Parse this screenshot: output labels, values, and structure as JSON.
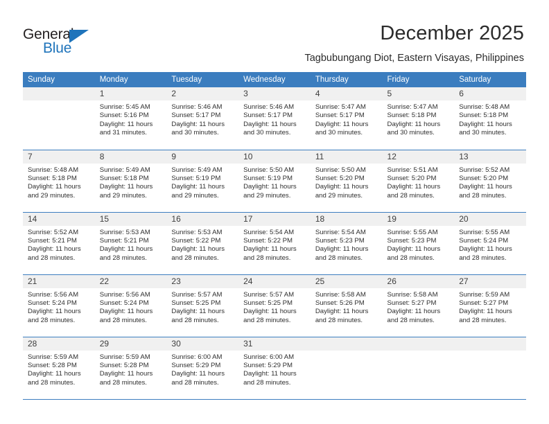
{
  "brand": {
    "name_top": "General",
    "name_bottom": "Blue",
    "accent_color": "#1f74bb"
  },
  "header": {
    "title": "December 2025",
    "subtitle": "Tagbubungang Diot, Eastern Visayas, Philippines"
  },
  "calendar": {
    "header_bg": "#3b7dbf",
    "daynum_bg": "#f0f0f0",
    "weekdays": [
      "Sunday",
      "Monday",
      "Tuesday",
      "Wednesday",
      "Thursday",
      "Friday",
      "Saturday"
    ],
    "weeks": [
      [
        {
          "day": "",
          "blank": true,
          "sunrise": "",
          "sunset": "",
          "daylight1": "",
          "daylight2": ""
        },
        {
          "day": "1",
          "sunrise": "Sunrise: 5:45 AM",
          "sunset": "Sunset: 5:16 PM",
          "daylight1": "Daylight: 11 hours",
          "daylight2": "and 31 minutes."
        },
        {
          "day": "2",
          "sunrise": "Sunrise: 5:46 AM",
          "sunset": "Sunset: 5:17 PM",
          "daylight1": "Daylight: 11 hours",
          "daylight2": "and 30 minutes."
        },
        {
          "day": "3",
          "sunrise": "Sunrise: 5:46 AM",
          "sunset": "Sunset: 5:17 PM",
          "daylight1": "Daylight: 11 hours",
          "daylight2": "and 30 minutes."
        },
        {
          "day": "4",
          "sunrise": "Sunrise: 5:47 AM",
          "sunset": "Sunset: 5:17 PM",
          "daylight1": "Daylight: 11 hours",
          "daylight2": "and 30 minutes."
        },
        {
          "day": "5",
          "sunrise": "Sunrise: 5:47 AM",
          "sunset": "Sunset: 5:18 PM",
          "daylight1": "Daylight: 11 hours",
          "daylight2": "and 30 minutes."
        },
        {
          "day": "6",
          "sunrise": "Sunrise: 5:48 AM",
          "sunset": "Sunset: 5:18 PM",
          "daylight1": "Daylight: 11 hours",
          "daylight2": "and 30 minutes."
        }
      ],
      [
        {
          "day": "7",
          "sunrise": "Sunrise: 5:48 AM",
          "sunset": "Sunset: 5:18 PM",
          "daylight1": "Daylight: 11 hours",
          "daylight2": "and 29 minutes."
        },
        {
          "day": "8",
          "sunrise": "Sunrise: 5:49 AM",
          "sunset": "Sunset: 5:18 PM",
          "daylight1": "Daylight: 11 hours",
          "daylight2": "and 29 minutes."
        },
        {
          "day": "9",
          "sunrise": "Sunrise: 5:49 AM",
          "sunset": "Sunset: 5:19 PM",
          "daylight1": "Daylight: 11 hours",
          "daylight2": "and 29 minutes."
        },
        {
          "day": "10",
          "sunrise": "Sunrise: 5:50 AM",
          "sunset": "Sunset: 5:19 PM",
          "daylight1": "Daylight: 11 hours",
          "daylight2": "and 29 minutes."
        },
        {
          "day": "11",
          "sunrise": "Sunrise: 5:50 AM",
          "sunset": "Sunset: 5:20 PM",
          "daylight1": "Daylight: 11 hours",
          "daylight2": "and 29 minutes."
        },
        {
          "day": "12",
          "sunrise": "Sunrise: 5:51 AM",
          "sunset": "Sunset: 5:20 PM",
          "daylight1": "Daylight: 11 hours",
          "daylight2": "and 28 minutes."
        },
        {
          "day": "13",
          "sunrise": "Sunrise: 5:52 AM",
          "sunset": "Sunset: 5:20 PM",
          "daylight1": "Daylight: 11 hours",
          "daylight2": "and 28 minutes."
        }
      ],
      [
        {
          "day": "14",
          "sunrise": "Sunrise: 5:52 AM",
          "sunset": "Sunset: 5:21 PM",
          "daylight1": "Daylight: 11 hours",
          "daylight2": "and 28 minutes."
        },
        {
          "day": "15",
          "sunrise": "Sunrise: 5:53 AM",
          "sunset": "Sunset: 5:21 PM",
          "daylight1": "Daylight: 11 hours",
          "daylight2": "and 28 minutes."
        },
        {
          "day": "16",
          "sunrise": "Sunrise: 5:53 AM",
          "sunset": "Sunset: 5:22 PM",
          "daylight1": "Daylight: 11 hours",
          "daylight2": "and 28 minutes."
        },
        {
          "day": "17",
          "sunrise": "Sunrise: 5:54 AM",
          "sunset": "Sunset: 5:22 PM",
          "daylight1": "Daylight: 11 hours",
          "daylight2": "and 28 minutes."
        },
        {
          "day": "18",
          "sunrise": "Sunrise: 5:54 AM",
          "sunset": "Sunset: 5:23 PM",
          "daylight1": "Daylight: 11 hours",
          "daylight2": "and 28 minutes."
        },
        {
          "day": "19",
          "sunrise": "Sunrise: 5:55 AM",
          "sunset": "Sunset: 5:23 PM",
          "daylight1": "Daylight: 11 hours",
          "daylight2": "and 28 minutes."
        },
        {
          "day": "20",
          "sunrise": "Sunrise: 5:55 AM",
          "sunset": "Sunset: 5:24 PM",
          "daylight1": "Daylight: 11 hours",
          "daylight2": "and 28 minutes."
        }
      ],
      [
        {
          "day": "21",
          "sunrise": "Sunrise: 5:56 AM",
          "sunset": "Sunset: 5:24 PM",
          "daylight1": "Daylight: 11 hours",
          "daylight2": "and 28 minutes."
        },
        {
          "day": "22",
          "sunrise": "Sunrise: 5:56 AM",
          "sunset": "Sunset: 5:24 PM",
          "daylight1": "Daylight: 11 hours",
          "daylight2": "and 28 minutes."
        },
        {
          "day": "23",
          "sunrise": "Sunrise: 5:57 AM",
          "sunset": "Sunset: 5:25 PM",
          "daylight1": "Daylight: 11 hours",
          "daylight2": "and 28 minutes."
        },
        {
          "day": "24",
          "sunrise": "Sunrise: 5:57 AM",
          "sunset": "Sunset: 5:25 PM",
          "daylight1": "Daylight: 11 hours",
          "daylight2": "and 28 minutes."
        },
        {
          "day": "25",
          "sunrise": "Sunrise: 5:58 AM",
          "sunset": "Sunset: 5:26 PM",
          "daylight1": "Daylight: 11 hours",
          "daylight2": "and 28 minutes."
        },
        {
          "day": "26",
          "sunrise": "Sunrise: 5:58 AM",
          "sunset": "Sunset: 5:27 PM",
          "daylight1": "Daylight: 11 hours",
          "daylight2": "and 28 minutes."
        },
        {
          "day": "27",
          "sunrise": "Sunrise: 5:59 AM",
          "sunset": "Sunset: 5:27 PM",
          "daylight1": "Daylight: 11 hours",
          "daylight2": "and 28 minutes."
        }
      ],
      [
        {
          "day": "28",
          "sunrise": "Sunrise: 5:59 AM",
          "sunset": "Sunset: 5:28 PM",
          "daylight1": "Daylight: 11 hours",
          "daylight2": "and 28 minutes."
        },
        {
          "day": "29",
          "sunrise": "Sunrise: 5:59 AM",
          "sunset": "Sunset: 5:28 PM",
          "daylight1": "Daylight: 11 hours",
          "daylight2": "and 28 minutes."
        },
        {
          "day": "30",
          "sunrise": "Sunrise: 6:00 AM",
          "sunset": "Sunset: 5:29 PM",
          "daylight1": "Daylight: 11 hours",
          "daylight2": "and 28 minutes."
        },
        {
          "day": "31",
          "sunrise": "Sunrise: 6:00 AM",
          "sunset": "Sunset: 5:29 PM",
          "daylight1": "Daylight: 11 hours",
          "daylight2": "and 28 minutes."
        },
        {
          "day": "",
          "blank": true,
          "sunrise": "",
          "sunset": "",
          "daylight1": "",
          "daylight2": ""
        },
        {
          "day": "",
          "blank": true,
          "sunrise": "",
          "sunset": "",
          "daylight1": "",
          "daylight2": ""
        },
        {
          "day": "",
          "blank": true,
          "sunrise": "",
          "sunset": "",
          "daylight1": "",
          "daylight2": ""
        }
      ]
    ]
  }
}
